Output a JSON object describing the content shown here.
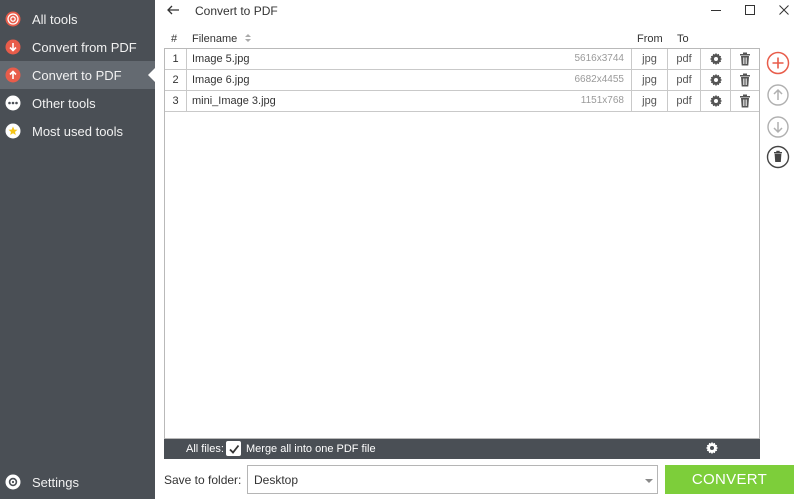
{
  "sidebar": {
    "items": [
      {
        "label": "All tools",
        "icon": "target-icon",
        "color": "#e85c4a"
      },
      {
        "label": "Convert from PDF",
        "icon": "arrow-down-circle-icon",
        "color": "#e85c4a"
      },
      {
        "label": "Convert to PDF",
        "icon": "arrow-up-circle-icon",
        "color": "#e85c4a",
        "active": true
      },
      {
        "label": "Other tools",
        "icon": "dots-icon",
        "color": "#ffffff"
      },
      {
        "label": "Most used tools",
        "icon": "star-icon",
        "color": "#f5c518"
      }
    ],
    "settings_label": "Settings"
  },
  "header": {
    "title": "Convert to PDF"
  },
  "table": {
    "columns": {
      "num": "#",
      "filename": "Filename",
      "from": "From",
      "to": "To"
    },
    "rows": [
      {
        "num": "1",
        "filename": "Image 5.jpg",
        "dims": "5616x3744",
        "from": "jpg",
        "to": "pdf"
      },
      {
        "num": "2",
        "filename": "Image 6.jpg",
        "dims": "6682x4455",
        "from": "jpg",
        "to": "pdf"
      },
      {
        "num": "3",
        "filename": "mini_Image 3.jpg",
        "dims": "1151x768",
        "from": "jpg",
        "to": "pdf"
      }
    ]
  },
  "footer": {
    "all_files_label": "All files:",
    "merge_label": "Merge all into one PDF file",
    "merge_checked": true
  },
  "bottom": {
    "save_label": "Save to folder:",
    "folder_value": "Desktop",
    "convert_label": "CONVERT"
  },
  "colors": {
    "sidebar_bg": "#4a4f55",
    "accent_red": "#e85c4a",
    "convert_green": "#7dce3a"
  }
}
